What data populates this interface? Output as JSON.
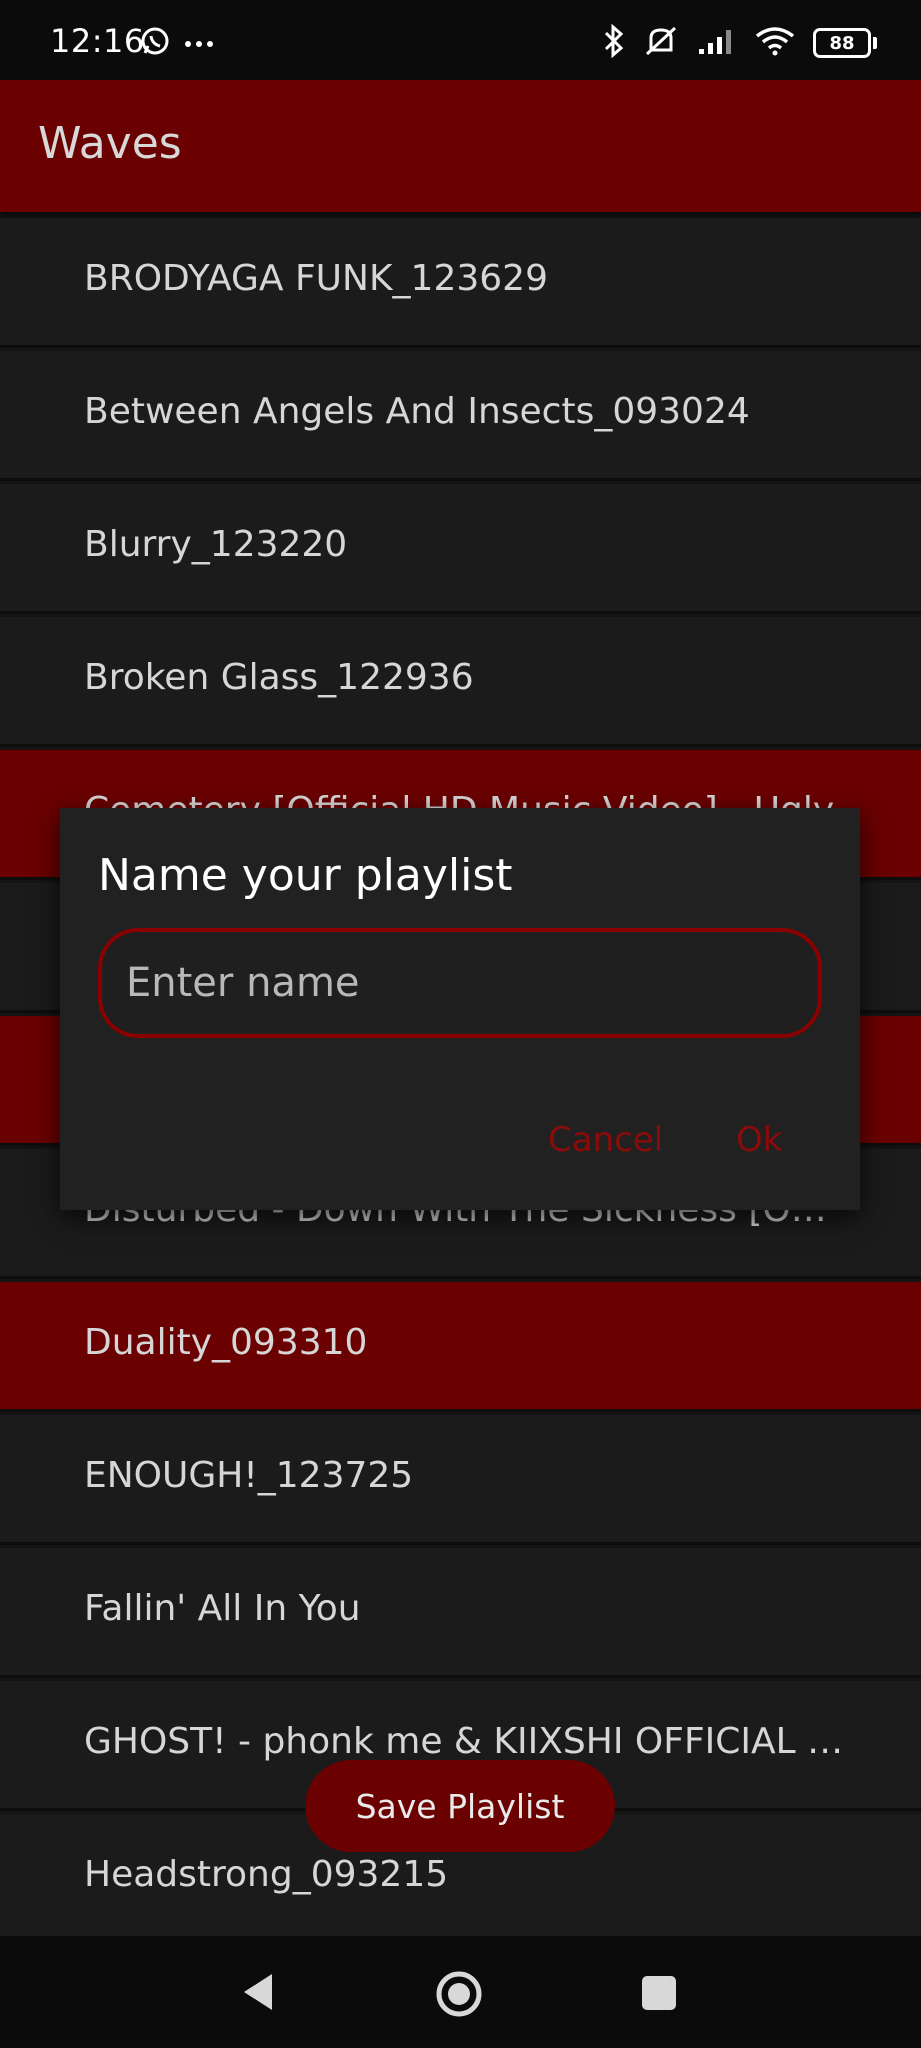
{
  "status_bar": {
    "time": "12:16",
    "battery": "88",
    "icons": [
      "whatsapp-icon",
      "more-dots-icon",
      "bluetooth-icon",
      "mute-icon",
      "signal-icon",
      "wifi-icon",
      "battery-icon"
    ]
  },
  "app_bar": {
    "title": "Waves"
  },
  "tracks": [
    {
      "label": "BRODYAGA FUNK_123629",
      "selected": false
    },
    {
      "label": "Between Angels And Insects_093024",
      "selected": false
    },
    {
      "label": "Blurry_123220",
      "selected": false
    },
    {
      "label": "Broken Glass_122936",
      "selected": false
    },
    {
      "label": "Cemetery [Official HD Music Video] - Ugly",
      "selected": true
    },
    {
      "label": "",
      "selected": false
    },
    {
      "label": "",
      "selected": true
    },
    {
      "label": "Disturbed - Down With The Sickness [Off…",
      "selected": false
    },
    {
      "label": "Duality_093310",
      "selected": true
    },
    {
      "label": "ENOUGH!_123725",
      "selected": false
    },
    {
      "label": "Fallin' All In You",
      "selected": false
    },
    {
      "label": "GHOST! - phonk me & KIIXSHI  OFFICIAL …",
      "selected": false
    },
    {
      "label": "Headstrong_093215",
      "selected": false
    }
  ],
  "dialog": {
    "title": "Name your playlist",
    "input_placeholder": "Enter name",
    "input_value": "",
    "cancel_label": "Cancel",
    "ok_label": "Ok"
  },
  "save_button": {
    "label": "Save Playlist"
  },
  "colors": {
    "accent": "#6a0000",
    "dialog_button": "#8b0b0b",
    "background": "#1b1b1b"
  }
}
